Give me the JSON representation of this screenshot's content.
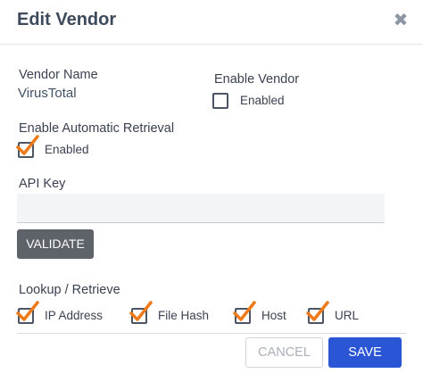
{
  "dialog": {
    "title": "Edit Vendor",
    "close_glyph": "✖",
    "close_icon": "close-icon"
  },
  "vendor_name": {
    "label": "Vendor Name",
    "value": "VirusTotal"
  },
  "enable_vendor": {
    "label": "Enable Vendor",
    "option_label": "Enabled",
    "checked": false
  },
  "auto_retrieval": {
    "label": "Enable Automatic Retrieval",
    "option_label": "Enabled",
    "checked": true
  },
  "api_key": {
    "label": "API Key",
    "value": "",
    "placeholder": ""
  },
  "validate_label": "VALIDATE",
  "lookup": {
    "label": "Lookup / Retrieve",
    "options": [
      {
        "label": "IP Address",
        "checked": true
      },
      {
        "label": "File Hash",
        "checked": true
      },
      {
        "label": "Host",
        "checked": true
      },
      {
        "label": "URL",
        "checked": true
      }
    ]
  },
  "footer": {
    "cancel_label": "CANCEL",
    "save_label": "SAVE"
  },
  "colors": {
    "check": "#ee7a1a",
    "primary": "#2a56d6",
    "validate_bg": "#5e6269"
  }
}
